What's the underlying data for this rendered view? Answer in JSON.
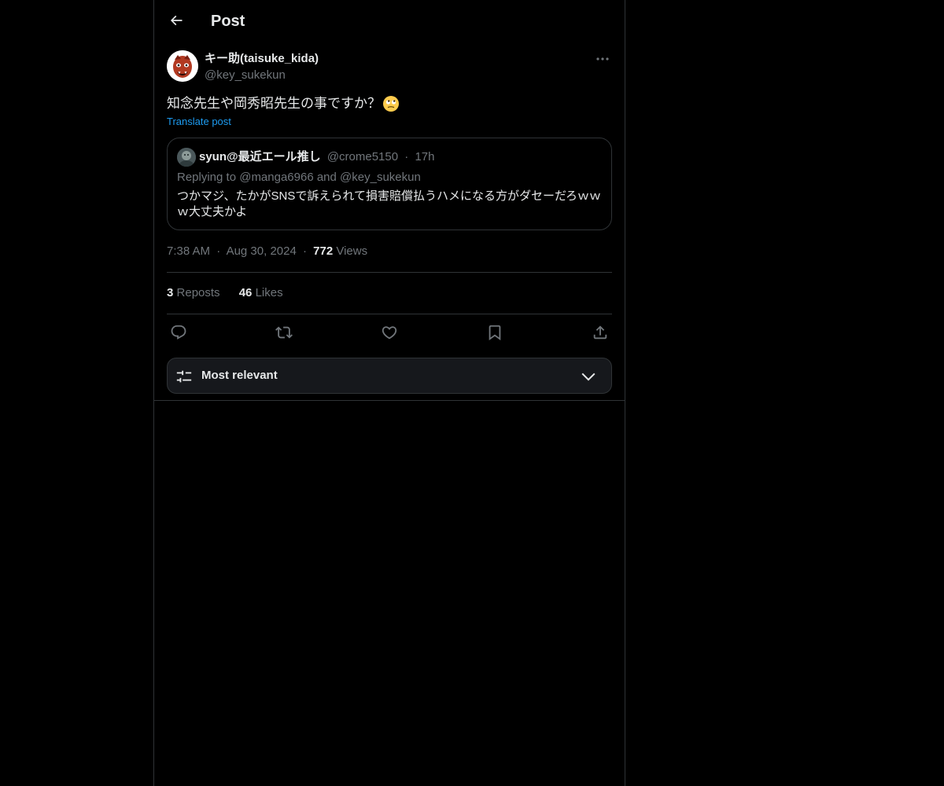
{
  "header": {
    "title": "Post",
    "back_icon": "arrow-left-icon"
  },
  "post": {
    "author": {
      "display_name": "キー助(taisuke_kida)",
      "handle": "@key_sukekun"
    },
    "text": "知念先生や岡秀昭先生の事ですか？",
    "emoji": "🙄",
    "translate_label": "Translate post",
    "quote": {
      "display_name": "syun@最近エール推し",
      "handle": "@crome5150",
      "separator": "·",
      "time": "17h",
      "reply_context": "Replying to @manga6966 and @key_sukekun",
      "text": "つかマジ、たかがSNSで訴えられて損害賠償払うハメになる方がダセーだろｗｗｗ大丈夫かよ"
    },
    "meta": {
      "time": "7:38 AM",
      "separator": "·",
      "date": "Aug 30, 2024",
      "views_count": "772",
      "views_label": "Views"
    },
    "stats": {
      "reposts_count": "3",
      "reposts_label": "Reposts",
      "likes_count": "46",
      "likes_label": "Likes"
    },
    "actions": [
      "reply-icon",
      "repost-icon",
      "like-icon",
      "bookmark-icon",
      "share-icon"
    ]
  },
  "replies": {
    "sort_label": "Most relevant",
    "sort_icon": "sliders-icon",
    "chevron_icon": "chevron-down-icon"
  },
  "colors": {
    "background": "#000000",
    "text_primary": "#e7e9ea",
    "text_secondary": "#71767b",
    "link": "#1d9bf0",
    "border": "#2f3336",
    "surface": "#16181c"
  }
}
